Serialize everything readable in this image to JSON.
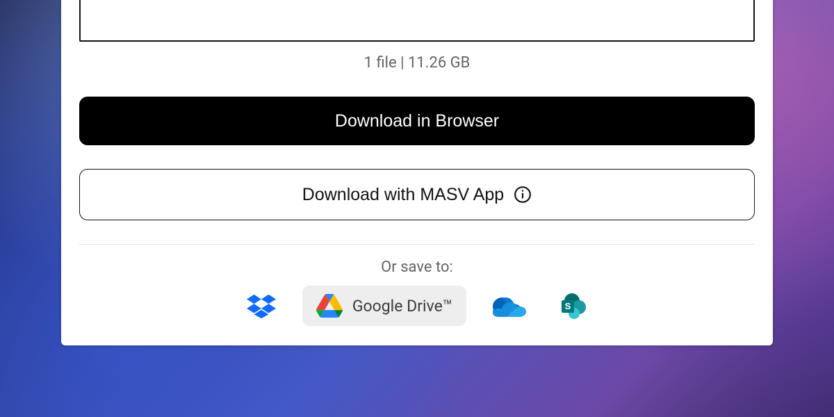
{
  "meta": {
    "summary": "1 file | 11.26 GB"
  },
  "buttons": {
    "primary": "Download in Browser",
    "secondary": "Download with MASV App"
  },
  "saveTo": {
    "label": "Or save to:",
    "googleDrive": "Google Drive™"
  }
}
